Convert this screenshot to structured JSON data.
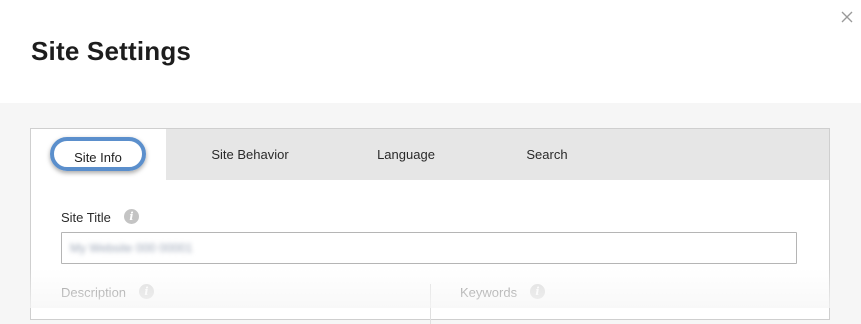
{
  "dialog": {
    "title": "Site Settings",
    "close_icon": "close-icon"
  },
  "tabs": [
    {
      "label": "Site Info",
      "active": true
    },
    {
      "label": "Site Behavior",
      "active": false
    },
    {
      "label": "Language",
      "active": false
    },
    {
      "label": "Search",
      "active": false
    }
  ],
  "fields": {
    "site_title": {
      "label": "Site Title",
      "value": "My Website 000 00001",
      "info_icon": "info-icon"
    },
    "description": {
      "label": "Description",
      "info_icon": "info-icon"
    },
    "keywords": {
      "label": "Keywords",
      "info_icon": "info-icon"
    }
  },
  "colors": {
    "active_tab_highlight": "#5b8fcc",
    "tab_bar_bg": "#e6e6e6",
    "info_icon": "#c4c4c4"
  }
}
